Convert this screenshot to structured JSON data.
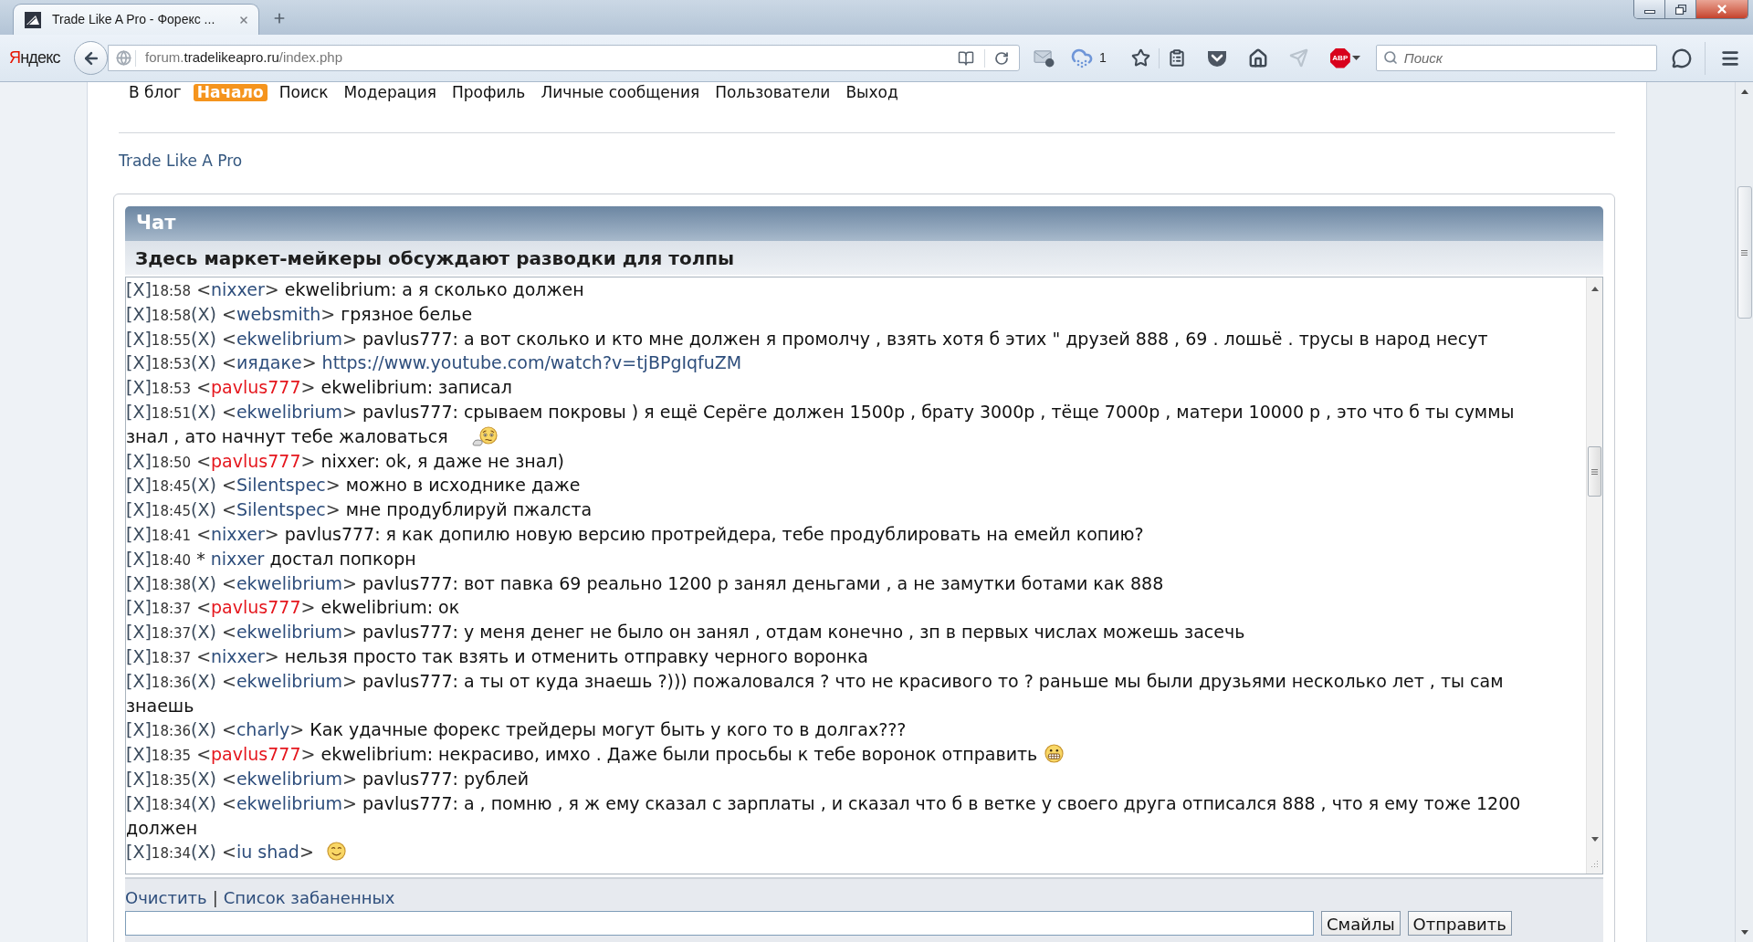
{
  "browser": {
    "tab": {
      "title": "Trade Like A Pro - Форекс ..."
    },
    "logo": {
      "initial": "Я",
      "rest": "ндекс"
    },
    "address": {
      "subdomain": "forum.",
      "domain": "tradelikeapro.ru",
      "path": "/index.php"
    },
    "weather_count": "1",
    "abp_label": "ABP",
    "search": {
      "placeholder": "Поиск"
    }
  },
  "nav": [
    {
      "label": "В блог",
      "selected": false
    },
    {
      "label": "Начало",
      "selected": true
    },
    {
      "label": "Поиск",
      "selected": false
    },
    {
      "label": "Модерация",
      "selected": false
    },
    {
      "label": "Профиль",
      "selected": false
    },
    {
      "label": "Личные сообщения",
      "selected": false
    },
    {
      "label": "Пользователи",
      "selected": false
    },
    {
      "label": "Выход",
      "selected": false
    }
  ],
  "breadcrumb": "Trade Like A Pro",
  "chat": {
    "title": "Чат",
    "subtitle": "Здесь маркет-мейкеры обсуждают разводки для толпы",
    "messages": [
      {
        "kind": "message",
        "delete": "[X]",
        "time": "18:58",
        "open": "<",
        "user": "nixxer",
        "close": ">",
        "color": "#2e4e7c",
        "text": "ekwelibrium: а я сколько должен"
      },
      {
        "kind": "message",
        "delete": "[X]",
        "time": "18:58",
        "ban": "(X)",
        "open": "<",
        "user": "websmith",
        "close": ">",
        "color": "#2e4e7c",
        "text": "грязное белье"
      },
      {
        "kind": "message",
        "delete": "[X]",
        "time": "18:55",
        "ban": "(X)",
        "open": "<",
        "user": "ekwelibrium",
        "close": ">",
        "color": "#2e4e7c",
        "text": "pavlus777: а вот сколько и кто мне должен я промолчу , взять хотя б этих \" друзей 888 , 69 . лошьё . трусы в народ несут"
      },
      {
        "kind": "message",
        "delete": "[X]",
        "time": "18:53",
        "ban": "(X)",
        "open": "<",
        "user": "иядаке",
        "close": ">",
        "color": "#2e4e7c",
        "link": "https://www.youtube.com/watch?v=tjBPgIqfuZM"
      },
      {
        "kind": "message",
        "delete": "[X]",
        "time": "18:53",
        "open": "<",
        "user": "pavlus777",
        "close": ">",
        "color": "#e5161d",
        "text": "ekwelibrium: записал"
      },
      {
        "kind": "message",
        "delete": "[X]",
        "time": "18:51",
        "ban": "(X)",
        "open": "<",
        "user": "ekwelibrium",
        "close": ">",
        "color": "#2e4e7c",
        "text": "pavlus777: срываем покровы ) я ещё Серёге должен 1500р , брату 3000р , тёще 7000р , матери 10000 р , это что б ты суммы",
        "continuation": "знал , ато начнут тебе жаловаться",
        "emoticon": {
          "kind": "worried"
        }
      },
      {
        "kind": "message",
        "delete": "[X]",
        "time": "18:50",
        "open": "<",
        "user": "pavlus777",
        "close": ">",
        "color": "#e5161d",
        "text": "nixxer: ok, я даже не знал)"
      },
      {
        "kind": "message",
        "delete": "[X]",
        "time": "18:45",
        "ban": "(X)",
        "open": "<",
        "user": "Silentspec",
        "close": ">",
        "color": "#2e4e7c",
        "text": "можно в исходнике даже"
      },
      {
        "kind": "message",
        "delete": "[X]",
        "time": "18:45",
        "ban": "(X)",
        "open": "<",
        "user": "Silentspec",
        "close": ">",
        "color": "#2e4e7c",
        "text": "мне продублируй пжалста"
      },
      {
        "kind": "message",
        "delete": "[X]",
        "time": "18:41",
        "open": "<",
        "user": "nixxer",
        "close": ">",
        "color": "#2e4e7c",
        "text": "pavlus777: я как допилю новую версию протрейдера, тебе продублировать на емейл копию?"
      },
      {
        "kind": "action",
        "delete": "[X]",
        "time": "18:40",
        "star": "*",
        "user": "nixxer",
        "color": "#2e4e7c",
        "text": "достал попкорн"
      },
      {
        "kind": "message",
        "delete": "[X]",
        "time": "18:38",
        "ban": "(X)",
        "open": "<",
        "user": "ekwelibrium",
        "close": ">",
        "color": "#2e4e7c",
        "text": "pavlus777: вот павка 69 реально 1200 р занял деньгами , а не замутки ботами как 888"
      },
      {
        "kind": "message",
        "delete": "[X]",
        "time": "18:37",
        "open": "<",
        "user": "pavlus777",
        "close": ">",
        "color": "#e5161d",
        "text": "ekwelibrium: ок"
      },
      {
        "kind": "message",
        "delete": "[X]",
        "time": "18:37",
        "ban": "(X)",
        "open": "<",
        "user": "ekwelibrium",
        "close": ">",
        "color": "#2e4e7c",
        "text": "pavlus777: у меня денег не было он занял , отдам конечно , зп в первых числах можешь засечь"
      },
      {
        "kind": "message",
        "delete": "[X]",
        "time": "18:37",
        "open": "<",
        "user": "nixxer",
        "close": ">",
        "color": "#2e4e7c",
        "text": "нельзя просто так взять и отменить отправку черного воронка"
      },
      {
        "kind": "message",
        "delete": "[X]",
        "time": "18:36",
        "ban": "(X)",
        "open": "<",
        "user": "ekwelibrium",
        "close": ">",
        "color": "#2e4e7c",
        "text": "pavlus777: а ты от куда знаешь ?))) пожаловался ? что не красивого то ? раньше мы были друзьями несколько лет , ты сам",
        "continuation": "знаешь"
      },
      {
        "kind": "message",
        "delete": "[X]",
        "time": "18:36",
        "ban": "(X)",
        "open": "<",
        "user": "charly",
        "close": ">",
        "color": "#2e4e7c",
        "text": "Как удачные форекс трейдеры могут быть у кого то в долгах???"
      },
      {
        "kind": "message",
        "delete": "[X]",
        "time": "18:35",
        "open": "<",
        "user": "pavlus777",
        "close": ">",
        "color": "#e5161d",
        "text": "ekwelibrium: некрасиво, имхо . Даже были просьбы к тебе воронок отправить",
        "emoticon": {
          "kind": "grin"
        }
      },
      {
        "kind": "message",
        "delete": "[X]",
        "time": "18:35",
        "ban": "(X)",
        "open": "<",
        "user": "ekwelibrium",
        "close": ">",
        "color": "#2e4e7c",
        "text": "pavlus777: рублей"
      },
      {
        "kind": "message",
        "delete": "[X]",
        "time": "18:34",
        "ban": "(X)",
        "open": "<",
        "user": "ekwelibrium",
        "close": ">",
        "color": "#2e4e7c",
        "text": "pavlus777: а , помню , я ж ему сказал с зарплаты , и сказал что б в ветке у своего друга отписался 888 , что я ему тоже 1200",
        "continuation": "должен"
      },
      {
        "kind": "message",
        "delete": "[X]",
        "time": "18:34",
        "ban": "(X)",
        "open": "<",
        "user": "iu shad",
        "close": ">",
        "color": "#2e4e7c",
        "emoticon": {
          "kind": "smile"
        }
      }
    ],
    "links": [
      {
        "label": "Очистить"
      },
      {
        "label": "Список забаненных"
      }
    ],
    "separator": "|",
    "buttons": [
      "Смайлы",
      "Отправить"
    ]
  }
}
